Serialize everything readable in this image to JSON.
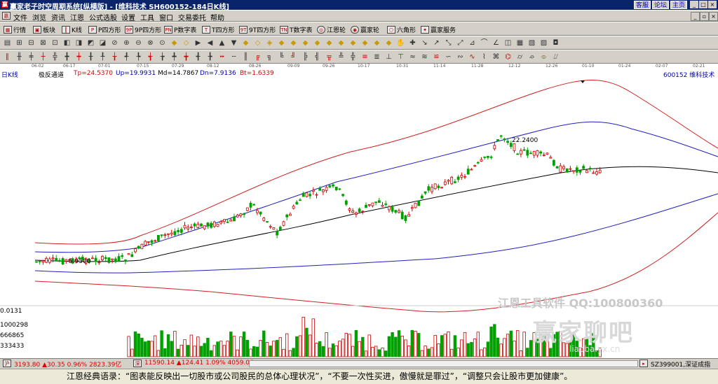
{
  "titlebar": {
    "title": "赢家老子时空周期系统[纵横版] - [维科技术  SH600152-184日K线]",
    "links": [
      "客服",
      "论坛",
      "主页"
    ]
  },
  "menubar": {
    "items": [
      "文件",
      "浏览",
      "资讯",
      "江恩",
      "公式选股",
      "设置",
      "工具",
      "窗口",
      "交易委托",
      "帮助"
    ]
  },
  "toolbar1": {
    "items": [
      {
        "label": "行情",
        "icon": "grid-icon"
      },
      {
        "label": "板块",
        "icon": "blocks-icon"
      },
      {
        "label": "K线",
        "icon": "candle-icon"
      },
      {
        "label": "P四方形",
        "icon": "square-p-icon"
      },
      {
        "label": "9P四方形",
        "icon": "square-9p-icon"
      },
      {
        "label": "P数字表",
        "icon": "table-p-icon"
      },
      {
        "label": "T四方形",
        "icon": "square-t-icon"
      },
      {
        "label": "9T四方形",
        "icon": "square-9t-icon"
      },
      {
        "label": "T数字表",
        "icon": "table-t-icon"
      },
      {
        "label": "江恩轮",
        "icon": "wheel-icon"
      },
      {
        "label": "赢家轮",
        "icon": "winner-wheel-icon"
      },
      {
        "label": "六角形",
        "icon": "hexagon-icon"
      },
      {
        "label": "赢家服务",
        "icon": "service-icon"
      }
    ]
  },
  "datebar": [
    "06-02",
    "06-17",
    "07-01",
    "07-15",
    "07-29",
    "08-12",
    "08-26",
    "09-09",
    "09-26",
    "10-17",
    "10-31",
    "11-14",
    "11-28",
    "12-12",
    "12-26",
    "01-10",
    "01-24",
    "02-07",
    "02-21"
  ],
  "infobar": {
    "period": "日K线",
    "indicator": "极反通道",
    "tp": "Tp=24.5370",
    "up": "Up=19.9931",
    "md": "Md=14.7867",
    "dn": "Dn=7.9136",
    "bt": "Bt=1.6339",
    "stock": "600152 维科技术"
  },
  "chart_data": {
    "type": "candlestick",
    "price_labels": {
      "high": "22.2400",
      "low": "5.9500"
    },
    "volume_axis": [
      "0.0131",
      "1000298",
      "666865",
      "333433"
    ],
    "series": [
      {
        "name": "Tp",
        "color": "#d02020"
      },
      {
        "name": "Up",
        "color": "#2020c0"
      },
      {
        "name": "Md",
        "color": "#000000"
      },
      {
        "name": "Dn",
        "color": "#2020c0"
      },
      {
        "name": "Bt",
        "color": "#d02020"
      }
    ],
    "colors": {
      "up": "#d00000",
      "down": "#00a000"
    }
  },
  "watermark": {
    "line1": "江恩工具软件  QQ:100800360",
    "line2": "赢家聊吧",
    "line3": "liaoba.yx.cn"
  },
  "ticker": {
    "sh": "3193.80 ▲30.35 0.96% 2823.39亿",
    "sz": "11590.14 ▲124.41 1.09% 4059.06",
    "sz_code": "SZ399001,深证成指"
  },
  "footer": {
    "quote": "江恩经典语录：“图表能反映出一切股市或公司股民的总体心理状况”，“不要一次性买进，傲慢就是罪过”，“调整只会让股市更加健康”。"
  }
}
